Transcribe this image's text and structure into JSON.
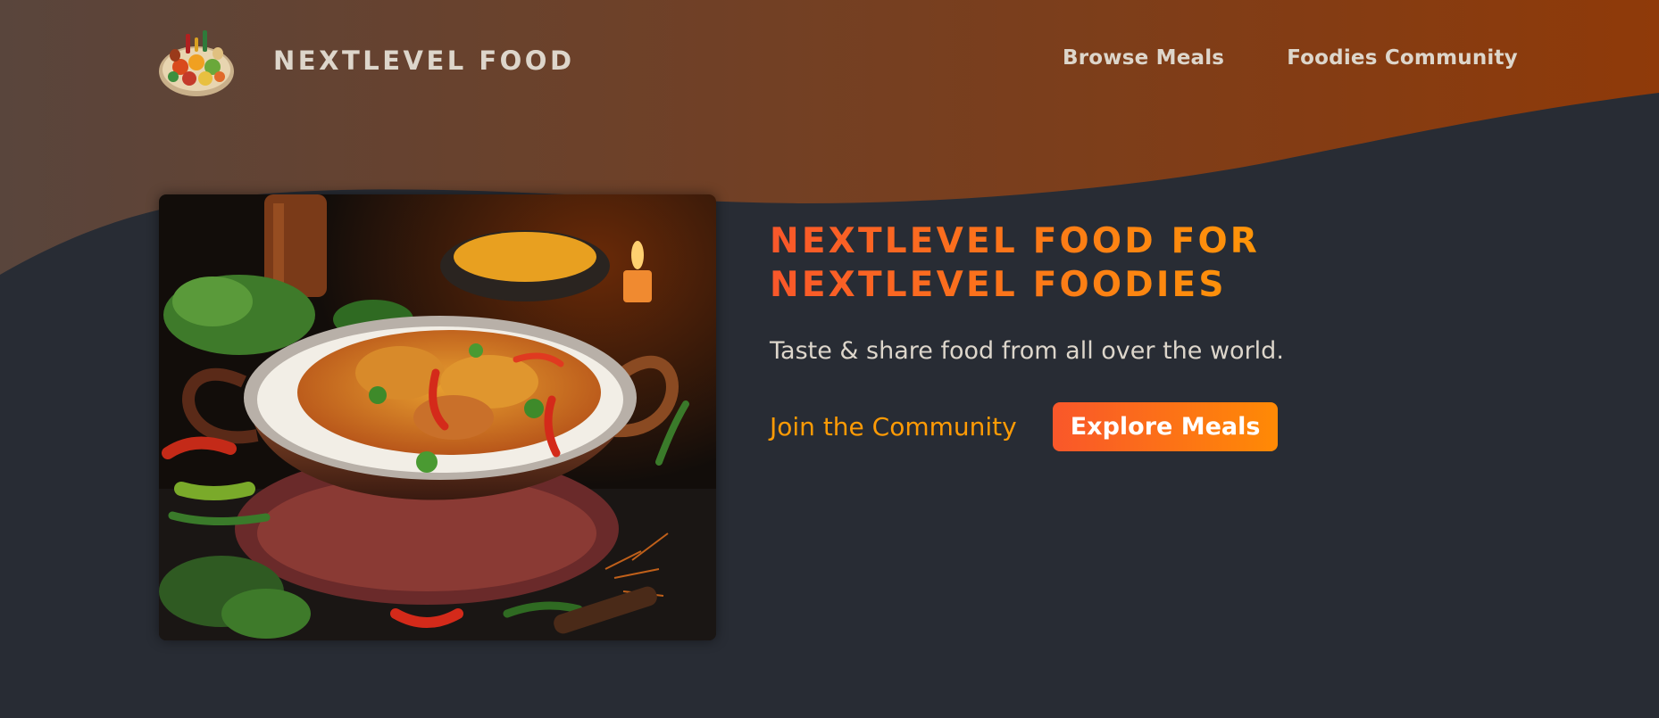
{
  "colors": {
    "background": "#282c34",
    "accent_start": "#f9572a",
    "accent_end": "#ff9b05",
    "nav_text": "#ddd6cb",
    "header_gradient_start": "#59453c",
    "header_gradient_end": "#8f3a09"
  },
  "header": {
    "logo_alt": "A plate with food on it",
    "logo_text": "NextLevel Food",
    "nav": [
      {
        "label": "Browse Meals"
      },
      {
        "label": "Foodies Community"
      }
    ]
  },
  "hero": {
    "image_alt": "A bowl of curry with rice",
    "title_line1": "NextLevel Food for",
    "title_line2": "NextLevel Foodies",
    "subtitle": "Taste & share food from all over the world.",
    "join_link": "Join the Community",
    "explore_button": "Explore Meals"
  }
}
